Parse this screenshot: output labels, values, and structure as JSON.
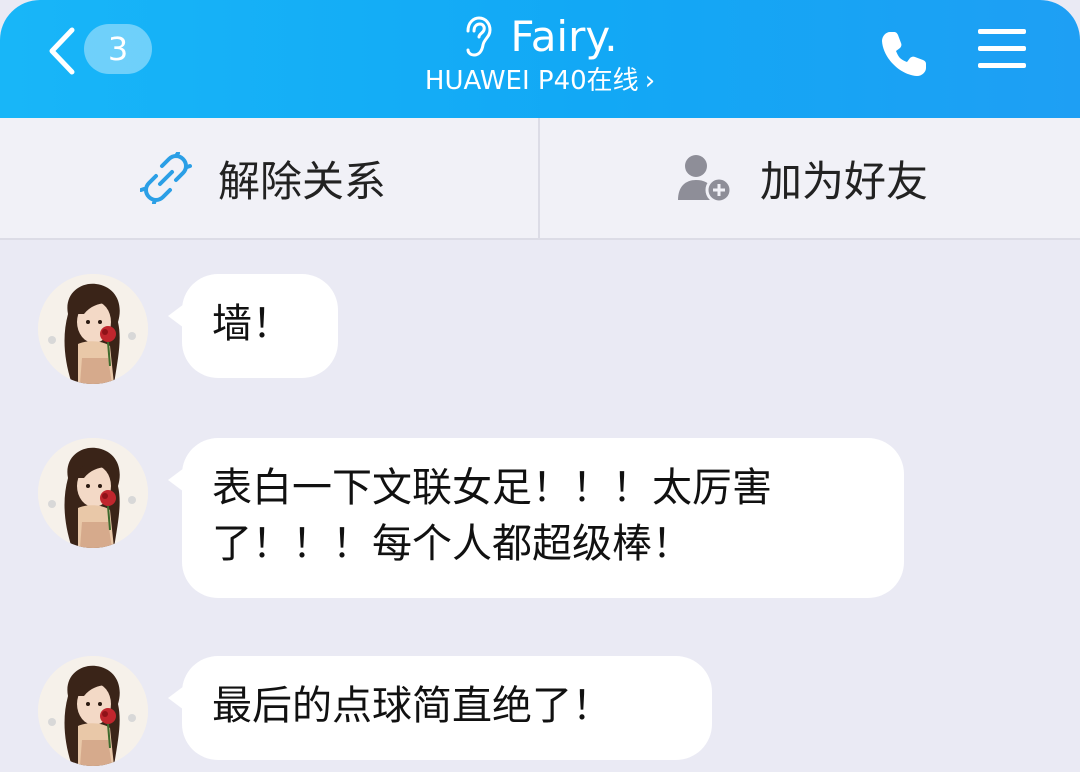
{
  "header": {
    "unread_count": "3",
    "title": "Fairy.",
    "subtitle": "HUAWEI P40在线",
    "subtitle_arrow": "›",
    "background_color": "#18b6f8"
  },
  "actions": {
    "unlink_label": "解除关系",
    "add_friend_label": "加为好友"
  },
  "messages": [
    {
      "text": "墙！"
    },
    {
      "line1": "表白一下文联女足！！！太厉害",
      "line2": "了！！！每个人都超级棒！"
    },
    {
      "text": "最后的点球简直绝了！"
    }
  ],
  "icons": {
    "back": "chevron-left-icon",
    "ear": "ear-icon",
    "phone": "phone-icon",
    "menu": "menu-icon",
    "unlink": "broken-link-icon",
    "add_friend": "add-user-icon"
  }
}
